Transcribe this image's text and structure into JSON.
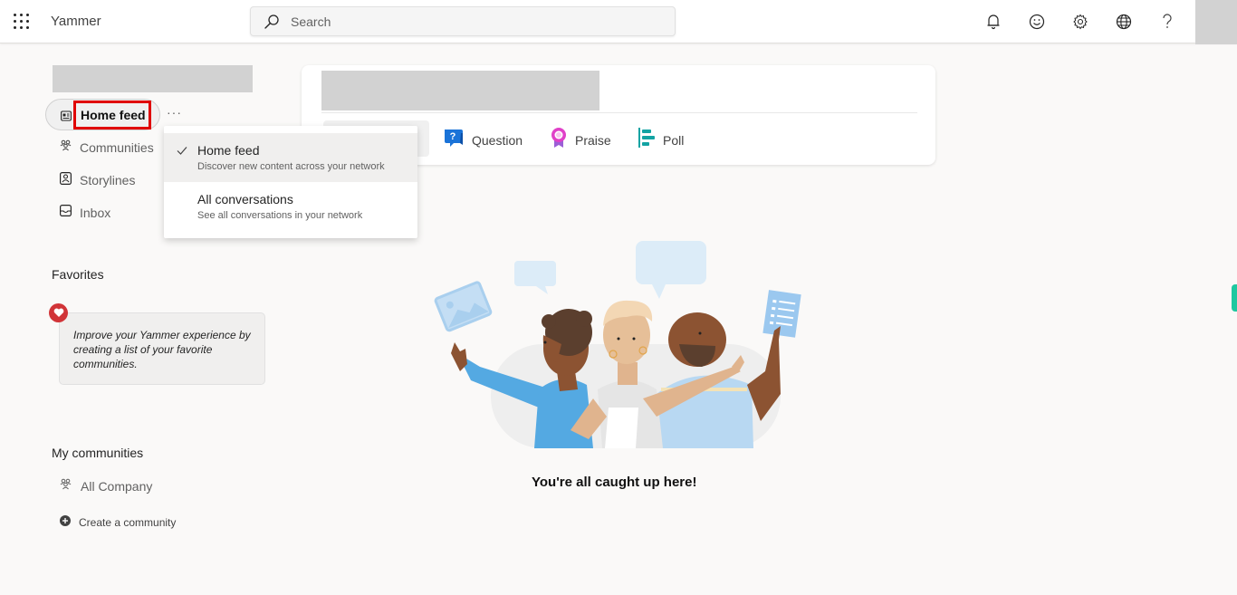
{
  "app": {
    "title": "Yammer"
  },
  "topbar": {
    "search_placeholder": "Search",
    "icons": [
      "bell-icon",
      "smiley-feedback-icon",
      "gear-icon",
      "globe-icon",
      "help-icon"
    ]
  },
  "nav": {
    "current": "Home feed",
    "more": "···",
    "items": [
      {
        "label": "Communities",
        "icon": "communities-icon"
      },
      {
        "label": "Storylines",
        "icon": "storylines-icon"
      },
      {
        "label": "Inbox",
        "icon": "inbox-icon"
      }
    ]
  },
  "dropdown": {
    "items": [
      {
        "title": "Home feed",
        "description": "Discover new content across your network",
        "selected": true
      },
      {
        "title": "All conversations",
        "description": "See all conversations in your network",
        "selected": false
      }
    ]
  },
  "favorites": {
    "title": "Favorites",
    "hint": "Improve your Yammer experience by creating a list of your favorite communities."
  },
  "my_communities": {
    "title": "My communities",
    "items": [
      {
        "label": "All Company"
      }
    ],
    "create_label": "Create a community"
  },
  "publisher": {
    "actions": [
      {
        "label": "Question",
        "icon": "question-icon",
        "color": "#1a73d8"
      },
      {
        "label": "Praise",
        "icon": "praise-icon",
        "color": "#e040c8"
      },
      {
        "label": "Poll",
        "icon": "poll-icon",
        "color": "#13a3a3"
      }
    ]
  },
  "empty_state": {
    "message": "You're all caught up here!"
  },
  "colors": {
    "highlight": "#e00000",
    "edge_tab": "#1ec8a0",
    "favorite_heart": "#d13438"
  }
}
